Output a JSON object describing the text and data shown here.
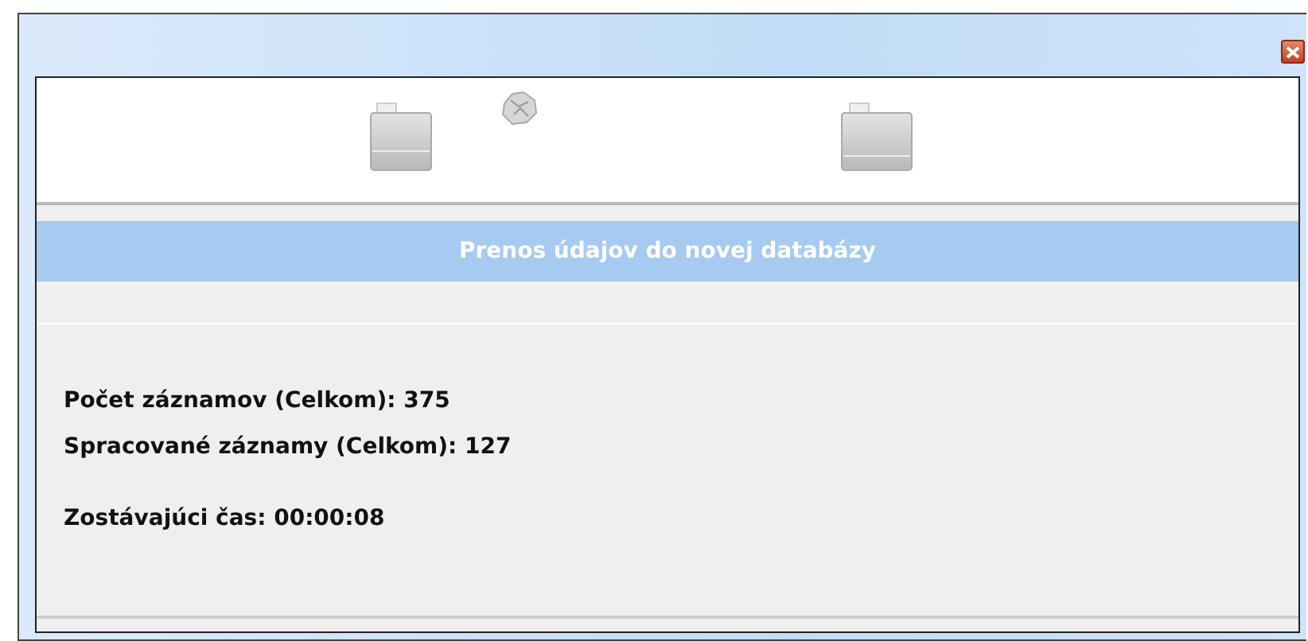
{
  "banner": {
    "title": "Prenos údajov do novej databázy"
  },
  "stat_groups": [
    {
      "lines": [
        "Počet záznamov (Celkom): 375",
        "Spracované záznamy (Celkom): 127"
      ]
    },
    {
      "lines": [
        "Zostávajúci čas: 00:00:08"
      ]
    }
  ]
}
